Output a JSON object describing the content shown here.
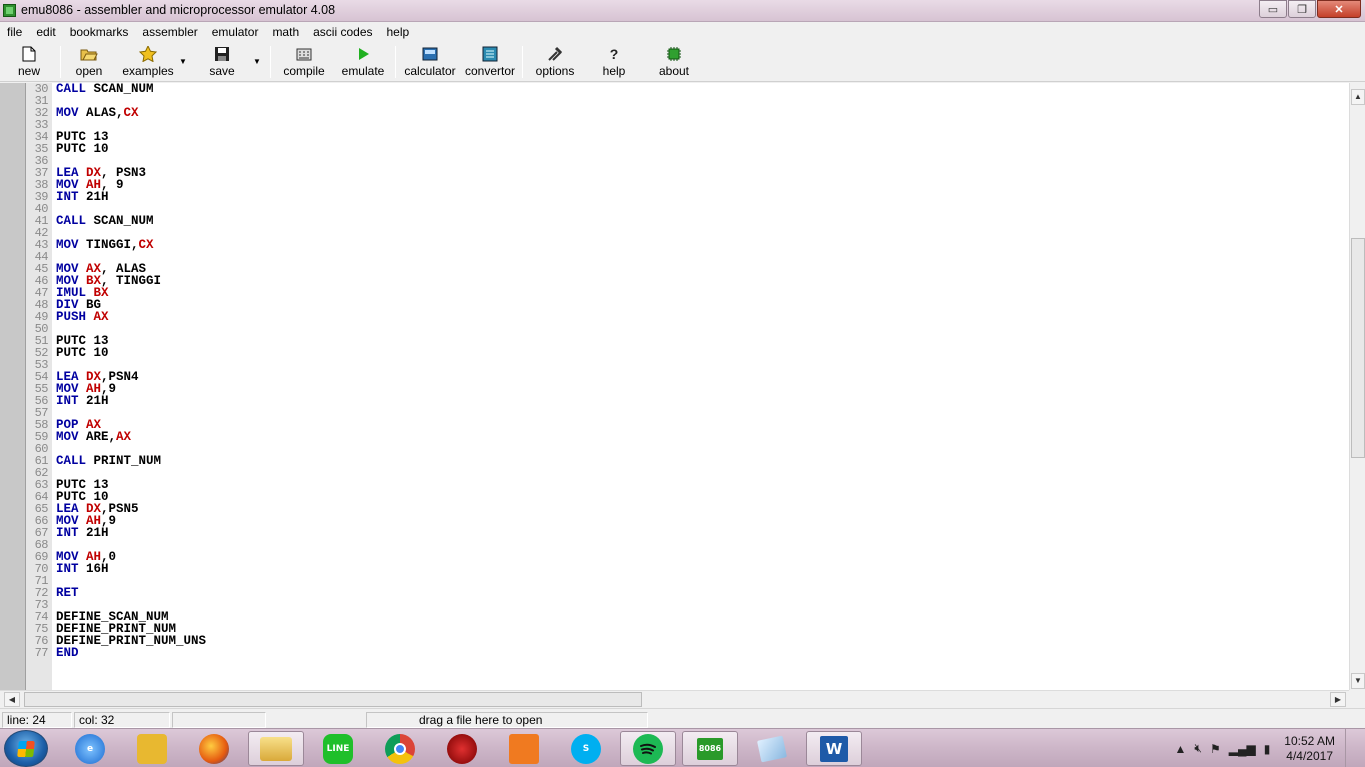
{
  "window": {
    "title": "emu8086 - assembler and microprocessor emulator 4.08",
    "buttons": {
      "minimize": "▭",
      "restore": "❐",
      "close": "✕"
    }
  },
  "menu": [
    "file",
    "edit",
    "bookmarks",
    "assembler",
    "emulator",
    "math",
    "ascii codes",
    "help"
  ],
  "toolbar": {
    "new": "new",
    "open": "open",
    "examples": "examples",
    "save": "save",
    "compile": "compile",
    "emulate": "emulate",
    "calculator": "calculator",
    "convertor": "convertor",
    "options": "options",
    "help": "help",
    "about": "about"
  },
  "editor": {
    "lines": [
      {
        "n": "30",
        "t": [
          [
            "kw",
            "CALL"
          ],
          [
            "p",
            " SCAN_NUM"
          ]
        ]
      },
      {
        "n": "31",
        "t": []
      },
      {
        "n": "32",
        "t": [
          [
            "kw",
            "MOV"
          ],
          [
            "p",
            " ALAS,"
          ],
          [
            "rg",
            "CX"
          ]
        ]
      },
      {
        "n": "33",
        "t": []
      },
      {
        "n": "34",
        "t": [
          [
            "p",
            "PUTC 13"
          ]
        ]
      },
      {
        "n": "35",
        "t": [
          [
            "p",
            "PUTC 10"
          ]
        ]
      },
      {
        "n": "36",
        "t": []
      },
      {
        "n": "37",
        "t": [
          [
            "kw",
            "LEA"
          ],
          [
            "p",
            " "
          ],
          [
            "rg",
            "DX"
          ],
          [
            "p",
            ", PSN3"
          ]
        ]
      },
      {
        "n": "38",
        "t": [
          [
            "kw",
            "MOV"
          ],
          [
            "p",
            " "
          ],
          [
            "rg",
            "AH"
          ],
          [
            "p",
            ", 9"
          ]
        ]
      },
      {
        "n": "39",
        "t": [
          [
            "kw",
            "INT"
          ],
          [
            "p",
            " 21H"
          ]
        ]
      },
      {
        "n": "40",
        "t": []
      },
      {
        "n": "41",
        "t": [
          [
            "kw",
            "CALL"
          ],
          [
            "p",
            " SCAN_NUM"
          ]
        ]
      },
      {
        "n": "42",
        "t": []
      },
      {
        "n": "43",
        "t": [
          [
            "kw",
            "MOV"
          ],
          [
            "p",
            " TINGGI,"
          ],
          [
            "rg",
            "CX"
          ]
        ]
      },
      {
        "n": "44",
        "t": []
      },
      {
        "n": "45",
        "t": [
          [
            "kw",
            "MOV"
          ],
          [
            "p",
            " "
          ],
          [
            "rg",
            "AX"
          ],
          [
            "p",
            ", ALAS"
          ]
        ]
      },
      {
        "n": "46",
        "t": [
          [
            "kw",
            "MOV"
          ],
          [
            "p",
            " "
          ],
          [
            "rg",
            "BX"
          ],
          [
            "p",
            ", TINGGI"
          ]
        ]
      },
      {
        "n": "47",
        "t": [
          [
            "kw",
            "IMUL"
          ],
          [
            "p",
            " "
          ],
          [
            "rg",
            "BX"
          ]
        ]
      },
      {
        "n": "48",
        "t": [
          [
            "kw",
            "DIV"
          ],
          [
            "p",
            " BG"
          ]
        ]
      },
      {
        "n": "49",
        "t": [
          [
            "kw",
            "PUSH"
          ],
          [
            "p",
            " "
          ],
          [
            "rg",
            "AX"
          ]
        ]
      },
      {
        "n": "50",
        "t": []
      },
      {
        "n": "51",
        "t": [
          [
            "p",
            "PUTC 13"
          ]
        ]
      },
      {
        "n": "52",
        "t": [
          [
            "p",
            "PUTC 10"
          ]
        ]
      },
      {
        "n": "53",
        "t": []
      },
      {
        "n": "54",
        "t": [
          [
            "kw",
            "LEA"
          ],
          [
            "p",
            " "
          ],
          [
            "rg",
            "DX"
          ],
          [
            "p",
            ",PSN4"
          ]
        ]
      },
      {
        "n": "55",
        "t": [
          [
            "kw",
            "MOV"
          ],
          [
            "p",
            " "
          ],
          [
            "rg",
            "AH"
          ],
          [
            "p",
            ",9"
          ]
        ]
      },
      {
        "n": "56",
        "t": [
          [
            "kw",
            "INT"
          ],
          [
            "p",
            " 21H"
          ]
        ]
      },
      {
        "n": "57",
        "t": []
      },
      {
        "n": "58",
        "t": [
          [
            "kw",
            "POP"
          ],
          [
            "p",
            " "
          ],
          [
            "rg",
            "AX"
          ]
        ]
      },
      {
        "n": "59",
        "t": [
          [
            "kw",
            "MOV"
          ],
          [
            "p",
            " ARE,"
          ],
          [
            "rg",
            "AX"
          ]
        ]
      },
      {
        "n": "60",
        "t": []
      },
      {
        "n": "61",
        "t": [
          [
            "kw",
            "CALL"
          ],
          [
            "p",
            " PRINT_NUM"
          ]
        ]
      },
      {
        "n": "62",
        "t": []
      },
      {
        "n": "63",
        "t": [
          [
            "p",
            "PUTC 13"
          ]
        ]
      },
      {
        "n": "64",
        "t": [
          [
            "p",
            "PUTC 10"
          ]
        ]
      },
      {
        "n": "65",
        "t": [
          [
            "kw",
            "LEA"
          ],
          [
            "p",
            " "
          ],
          [
            "rg",
            "DX"
          ],
          [
            "p",
            ",PSN5"
          ]
        ]
      },
      {
        "n": "66",
        "t": [
          [
            "kw",
            "MOV"
          ],
          [
            "p",
            " "
          ],
          [
            "rg",
            "AH"
          ],
          [
            "p",
            ",9"
          ]
        ]
      },
      {
        "n": "67",
        "t": [
          [
            "kw",
            "INT"
          ],
          [
            "p",
            " 21H"
          ]
        ]
      },
      {
        "n": "68",
        "t": []
      },
      {
        "n": "69",
        "t": [
          [
            "kw",
            "MOV"
          ],
          [
            "p",
            " "
          ],
          [
            "rg",
            "AH"
          ],
          [
            "p",
            ",0"
          ]
        ]
      },
      {
        "n": "70",
        "t": [
          [
            "kw",
            "INT"
          ],
          [
            "p",
            " 16H"
          ]
        ]
      },
      {
        "n": "71",
        "t": []
      },
      {
        "n": "72",
        "t": [
          [
            "kw",
            "RET"
          ]
        ]
      },
      {
        "n": "73",
        "t": []
      },
      {
        "n": "74",
        "t": [
          [
            "p",
            "DEFINE_SCAN_NUM"
          ]
        ]
      },
      {
        "n": "75",
        "t": [
          [
            "p",
            "DEFINE_PRINT_NUM"
          ]
        ]
      },
      {
        "n": "76",
        "t": [
          [
            "p",
            "DEFINE_PRINT_NUM_UNS"
          ]
        ]
      },
      {
        "n": "77",
        "t": [
          [
            "kw",
            "END"
          ]
        ]
      }
    ]
  },
  "status": {
    "line": "line: 24",
    "col": "col: 32",
    "drop_hint": "drag a file here to open"
  },
  "taskbar": {
    "apps": [
      "internet-explorer",
      "gadgets",
      "firefox",
      "file-explorer",
      "line",
      "chrome",
      "unknown-red",
      "orange-app",
      "skype",
      "spotify",
      "emu8086",
      "notepad",
      "word"
    ],
    "labels": {
      "line": "LINE",
      "emu": "8086",
      "word": "W"
    },
    "clock_time": "10:52 AM",
    "clock_date": "4/4/2017"
  },
  "colors": {
    "keyword": "#0000a0",
    "register": "#c00000",
    "gutter": "#e6e6e6"
  }
}
